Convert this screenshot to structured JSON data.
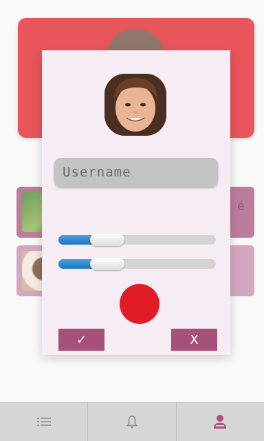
{
  "colors": {
    "accent_red": "#e01d24",
    "accent_plum": "#a6517a",
    "dialog_bg": "#f6ecf3",
    "slider_blue": "#1f74c4"
  },
  "background_screen": {
    "cards": [
      {
        "thumbnail": "green-food-image"
      },
      {
        "thumbnail": "plated-dish-image"
      }
    ]
  },
  "dialog": {
    "avatar_icon": "profile-photo",
    "username": {
      "value": "",
      "placeholder": "Username"
    },
    "sliders": [
      {
        "value_fraction": 0.2
      },
      {
        "value_fraction": 0.2
      }
    ],
    "record_icon": "red-circle",
    "confirm_label": "✓",
    "cancel_label": "X"
  },
  "bottom_nav": {
    "items": [
      {
        "icon": "list-icon"
      },
      {
        "icon": "bell-icon"
      },
      {
        "icon": "person-icon",
        "active": true
      }
    ]
  }
}
